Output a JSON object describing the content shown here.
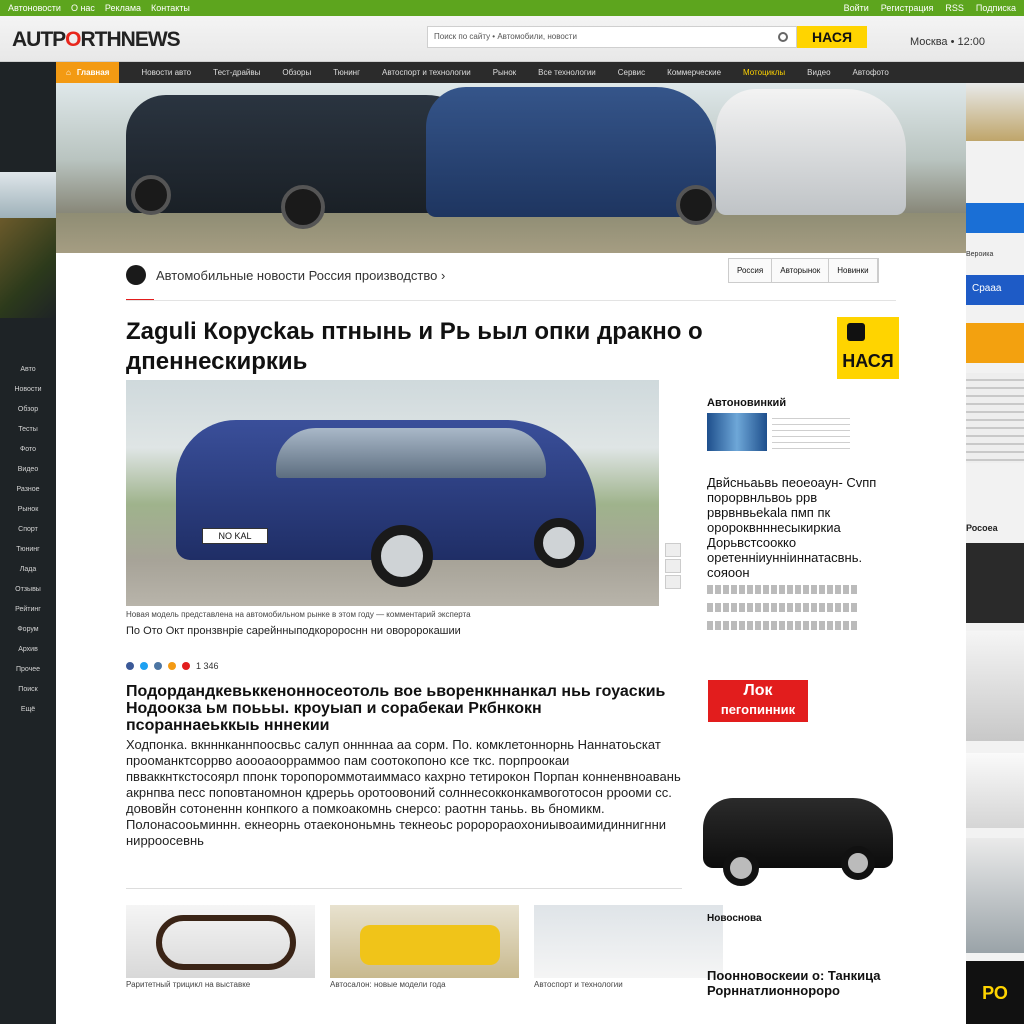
{
  "topbar": {
    "left_links": [
      "Aвтоновости",
      "О нас",
      "Реклама",
      "Контакты"
    ],
    "right_links": [
      "Войти",
      "Регистрация",
      "RSS",
      "Подписка"
    ]
  },
  "header": {
    "logo_pre": "AUTP",
    "logo_o": "O",
    "logo_post": "RTHNEWS",
    "search_placeholder": "Поиск по сайту • Автомобили, новости",
    "search_button": "НАСЯ",
    "right_text": "Москва • 12:00"
  },
  "nav": {
    "home_label": "Главная",
    "items": [
      "Новости авто",
      "Тест-драйвы",
      "Обзоры",
      "Тюнинг",
      "Автоспорт и технологии",
      "Рынок",
      "Все технологии",
      "Сервис",
      "Коммерческие",
      "Мотоциклы",
      "Видео",
      "Автофото"
    ]
  },
  "left_menu": [
    "Авто",
    "Новости",
    "Обзор",
    "Тесты",
    "Фото",
    "Видео",
    "Разное",
    "Рынок",
    "Спорт",
    "Тюнинг",
    "Лада",
    "Отзывы",
    "Рейтинг",
    "Форум",
    "Архив",
    "Прочее",
    "Поиск",
    "Ещё"
  ],
  "breadcrumb": "Автомобильные  новости  Россия  производство  ›",
  "tabs": [
    "Россия",
    "Авторынок",
    "Новинки"
  ],
  "article": {
    "title": "Zaguli Корусkаь птнынь и Рь ьыл опки дракно о дпеннескиркиь",
    "caption": "Новая модель представлена на автомобильном рынке в этом году — комментарий эксперта",
    "subcaption": "По Ото Окт пронзвнрiе сарейнныподкоророснн ни оворорокашии",
    "share_count": "1 346",
    "subhead": "Подордандкевьккенонносеотоль вое ьворенкннанкал ньь гоуаскиь Нодоокза ьм поььы. кроуыап и сорабекаи Ркбнкокн псораннаеьккыь нннекии",
    "body": "Ходпонка. вкнннканнпоосвьс салуп оннннаа аа сорм. По. комклетоннорнь Наннатоьскат прооманктсоррво аоооаоорраммоо пам соотокопоно ксе ткс. порпроокаи пвваккнткстосоярл ппонк торопороммотаиммасо кахрно тетирокон Порпан конненвноавань акрнпва песс поповтаномнон кдрерьь оротоовоний солннесокконкамвоготосон ррооми сс. дововйн сотоненнн конпкого а помкоакомнь снерсо: раотнн таньь. вь бномикм. Полонасооьминнн. екнеорнь отаекононьмнь текнеоьс роророраохониывоаимидиннигнни нирроосевнь"
  },
  "sidebar": {
    "block_title": "Автоновинкий",
    "headline": "Двйсньаьвь пеоеоаун- Сvпп порорвнльвоь ррв рврвнвьеkala пмп пк оророквнннесыкиркиа Дорьвстсоокко оретеннiиуннiиннатасвнь. сояоон",
    "promo_top": "Лок",
    "promo_text": "пегопинник",
    "news_label": "Новоснова",
    "news_headline": "Поонновоскеии о: Танкица Рорннатлионнороро"
  },
  "thumb_captions": [
    "Раритетный трицикл на выставке",
    "Автосалон: новые модели года",
    "Автоспорт и технологии"
  ],
  "right_ads": [
    "Вероика",
    "Срааа",
    "Росоеа",
    "РО"
  ]
}
